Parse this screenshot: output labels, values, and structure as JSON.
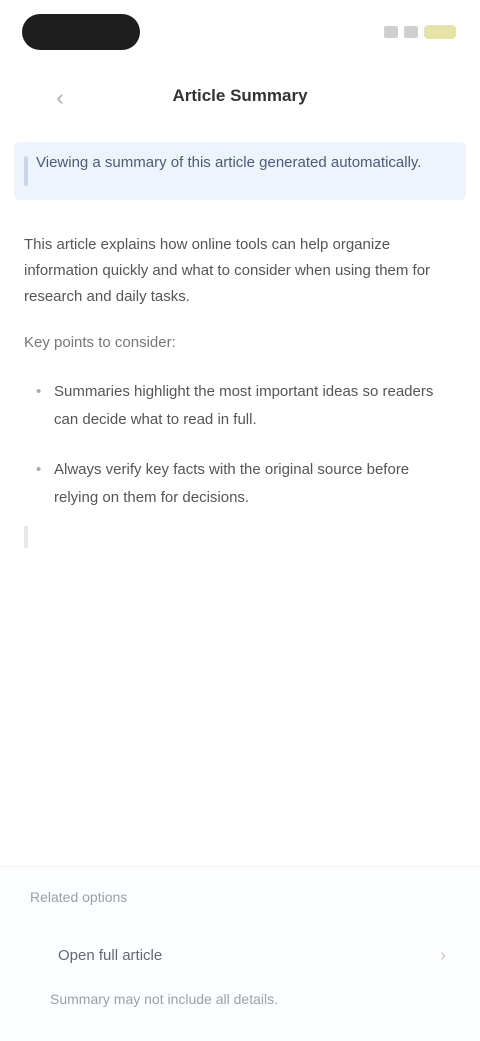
{
  "status_bar": {
    "time": "",
    "icons": [
      "signal-icon",
      "wifi-icon",
      "battery-icon"
    ]
  },
  "nav": {
    "back_icon": "chevron-left-icon",
    "title": "Article Summary"
  },
  "notice": {
    "text": "Viewing a summary of this article generated automatically."
  },
  "article": {
    "intro": "This article explains how online tools can help organize information quickly and what to consider when using them for research and daily tasks.",
    "subhead": "Key points to consider:",
    "bullets": [
      "Summaries highlight the most important ideas so readers can decide what to read in full.",
      "Always verify key facts with the original source before relying on them for decisions."
    ]
  },
  "sheet": {
    "title": "Related options",
    "row_label": "Open full article",
    "row_icon": "chevron-right-icon",
    "footer": "Summary may not include all details."
  },
  "colors": {
    "notice_bg": "#eef4fb",
    "status_pill": "#1e1e1e"
  }
}
